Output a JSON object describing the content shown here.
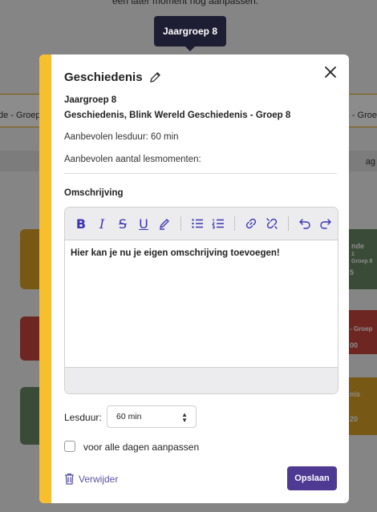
{
  "background": {
    "top_text": "een later moment nog aanpassen.",
    "tab_left": "de - Groep",
    "tab_right": "is - Groe",
    "head_right": "ag",
    "cards": [
      {
        "lines": [
          "nde",
          "1",
          "Groep 8",
          "5"
        ],
        "color": "#6b8a64"
      },
      {
        "lines": [
          "- Groep",
          "00"
        ],
        "color": "#c9453f"
      },
      {
        "lines": [
          "nis",
          "20"
        ],
        "color": "#d9a327"
      }
    ]
  },
  "tooltip": {
    "label": "Jaargroep 8"
  },
  "modal": {
    "title": "Geschiedenis",
    "group": "Jaargroep 8",
    "method": "Geschiedenis, Blink Wereld Geschiedenis - Groep 8",
    "duration_text": "Aanbevolen lesduur: 60 min",
    "moments_text": "Aanbevolen aantal lesmomenten:",
    "description_label": "Omschrijving",
    "editor_text": "Hier kan je nu je eigen omschrijving toevoegen!",
    "lesduur_label": "Lesduur:",
    "lesduur_value": "60 min",
    "checkbox_label": "voor alle dagen aanpassen",
    "delete_label": "Verwijder",
    "save_label": "Opslaan"
  },
  "colors": {
    "accent_stripe": "#f7bf2e",
    "primary": "#4f3a93",
    "toolbar_icon": "#3b35b5"
  }
}
